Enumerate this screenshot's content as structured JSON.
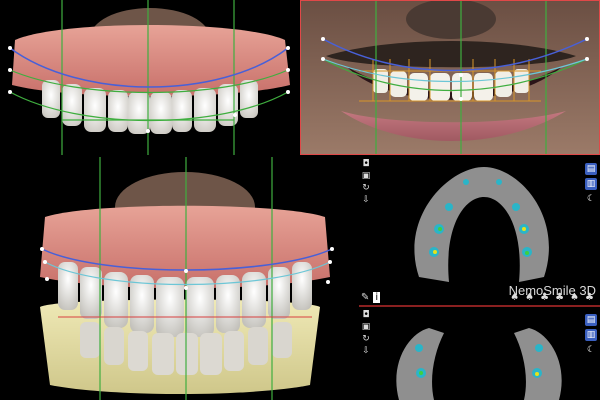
{
  "app": {
    "brand": "NemoSmile 3D"
  },
  "icons": {
    "left_toolbar": [
      "camera-icon",
      "image-icon",
      "rotate-icon",
      "download-icon"
    ],
    "right_toolbar": [
      "teeth-view-icon",
      "teeth-view-icon-2",
      "moon-icon"
    ],
    "bottom_left": [
      "pen-icon",
      "info-icon"
    ],
    "bottom_right": [
      "tooth-view-1-icon",
      "tooth-view-2-icon",
      "tooth-view-3-icon",
      "tooth-view-4-icon",
      "tooth-view-5-icon",
      "tooth-view-6-icon"
    ]
  },
  "colors": {
    "guide_green": "#3fae3f",
    "arch_blue": "#4860d8",
    "arch_cyan": "#6cc6d6",
    "mid_red": "#d84040",
    "orange": "#d8962a",
    "gum": "#d9867a",
    "tooth": "#ece9e2",
    "base": "#e7e2a8",
    "model_gray": "#8a8a8a"
  }
}
